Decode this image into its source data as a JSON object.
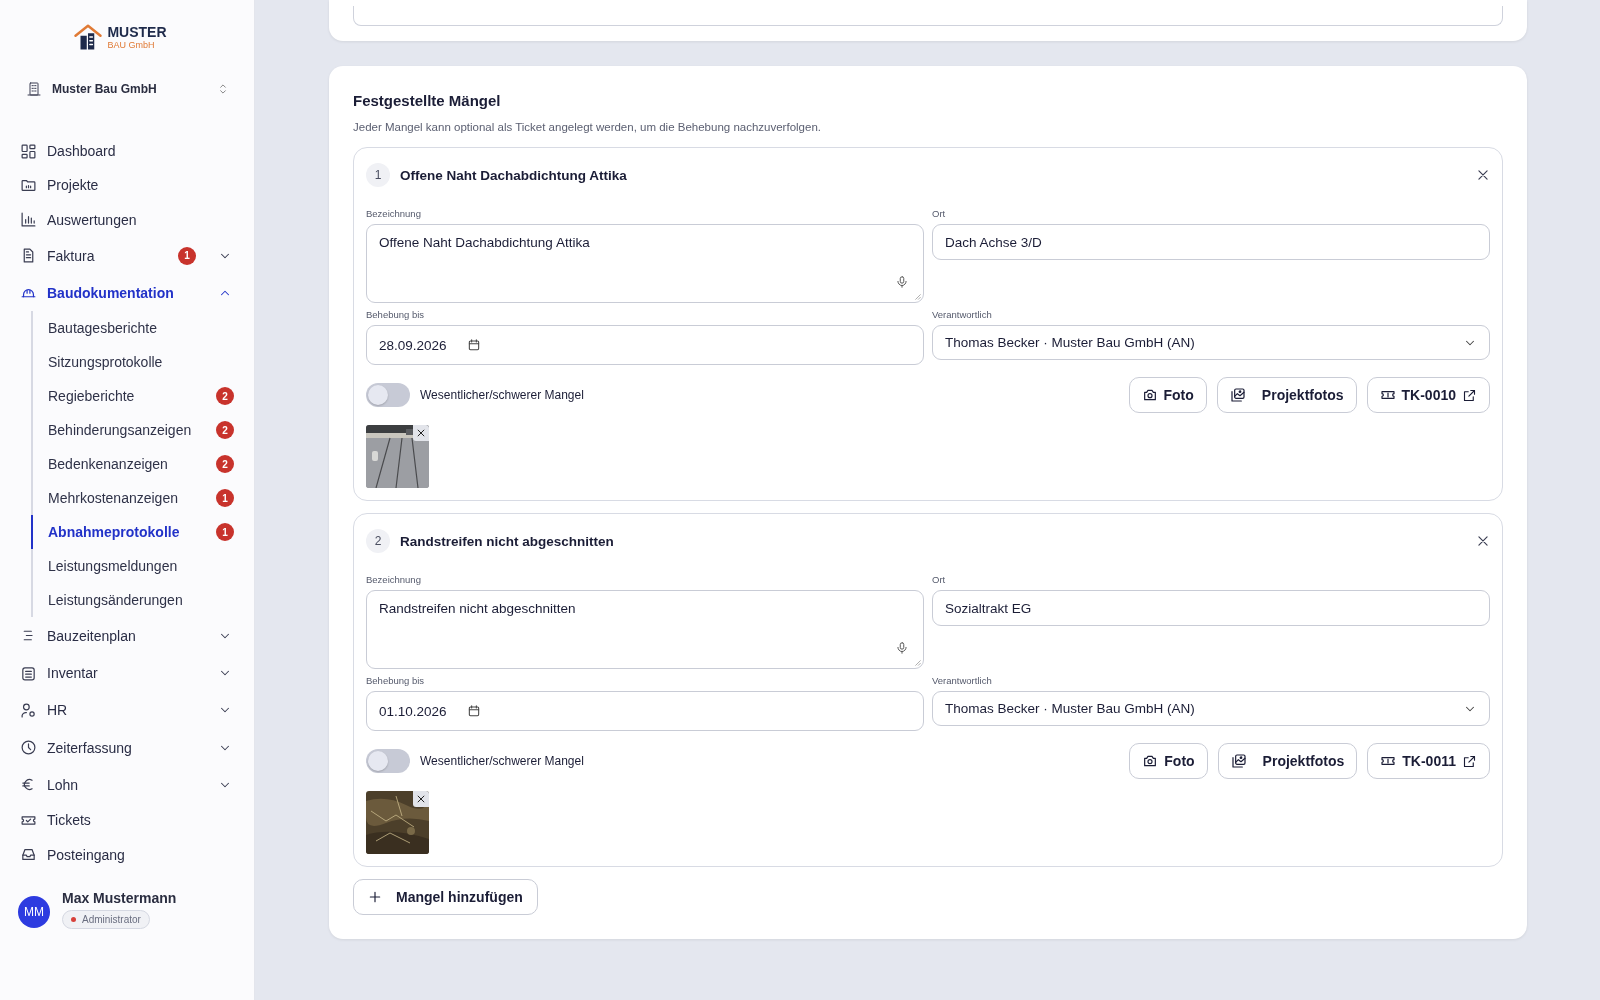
{
  "sidebar": {
    "logo": {
      "title": "MUSTER",
      "subtitle": "BAU GmbH"
    },
    "company": "Muster Bau GmbH",
    "nav": [
      {
        "label": "Dashboard",
        "selected": false
      },
      {
        "label": "Projekte",
        "selected": false
      },
      {
        "label": "Auswertungen",
        "selected": false
      },
      {
        "label": "Faktura",
        "selected": false,
        "badge": "1",
        "expanded": false
      },
      {
        "label": "Baudokumentation",
        "selected": true,
        "expanded": true,
        "children": [
          {
            "label": "Bautagesberichte",
            "selected": false
          },
          {
            "label": "Sitzungsprotokolle",
            "selected": false
          },
          {
            "label": "Regieberichte",
            "selected": false,
            "badge": "2"
          },
          {
            "label": "Behinderungsanzeigen",
            "selected": false,
            "badge": "2"
          },
          {
            "label": "Bedenkenanzeigen",
            "selected": false,
            "badge": "2"
          },
          {
            "label": "Mehrkostenanzeigen",
            "selected": false,
            "badge": "1"
          },
          {
            "label": "Abnahmeprotokolle",
            "selected": true,
            "badge": "1"
          },
          {
            "label": "Leistungsmeldungen",
            "selected": false
          },
          {
            "label": "Leistungsänderungen",
            "selected": false
          }
        ]
      },
      {
        "label": "Bauzeitenplan",
        "selected": false,
        "expanded": false
      },
      {
        "label": "Inventar",
        "selected": false,
        "expanded": false
      },
      {
        "label": "HR",
        "selected": false,
        "expanded": false
      },
      {
        "label": "Zeiterfassung",
        "selected": false,
        "expanded": false
      },
      {
        "label": "Lohn",
        "selected": false,
        "expanded": false
      },
      {
        "label": "Tickets",
        "selected": false
      },
      {
        "label": "Posteingang",
        "selected": false
      }
    ],
    "user": {
      "initials": "MM",
      "name": "Max Mustermann",
      "role": "Administrator"
    }
  },
  "defects": {
    "title": "Festgestellte Mängel",
    "description": "Jeder Mangel kann optional als Ticket angelegt werden, um die Behebung nachzuverfolgen.",
    "items": [
      {
        "number": "1",
        "title": "Offene Naht Dachabdichtung Attika",
        "designation_label": "Bezeichnung",
        "designation": "Offene Naht Dachabdichtung Attika",
        "location_label": "Ort",
        "location": "Dach Achse 3/D",
        "due_label": "Behebung bis",
        "due": "28.09.2026",
        "responsible_label": "Verantwortlich",
        "responsible": "Thomas Becker · Muster Bau GmbH (AN)",
        "severe": {
          "label": "Wesentlicher/schwerer Mangel",
          "on": false
        },
        "photo_button": "Foto",
        "project_photos_button": "Projektfotos",
        "ticket": "TK-0010"
      },
      {
        "number": "2",
        "title": "Randstreifen nicht abgeschnitten",
        "designation_label": "Bezeichnung",
        "designation": "Randstreifen nicht abgeschnitten",
        "location_label": "Ort",
        "location": "Sozialtrakt EG",
        "due_label": "Behebung bis",
        "due": "01.10.2026",
        "responsible_label": "Verantwortlich",
        "responsible": "Thomas Becker · Muster Bau GmbH (AN)",
        "severe": {
          "label": "Wesentlicher/schwerer Mangel",
          "on": false
        },
        "photo_button": "Foto",
        "project_photos_button": "Projektfotos",
        "ticket": "TK-0011"
      }
    ],
    "add_button": "Mangel hinzufügen"
  }
}
